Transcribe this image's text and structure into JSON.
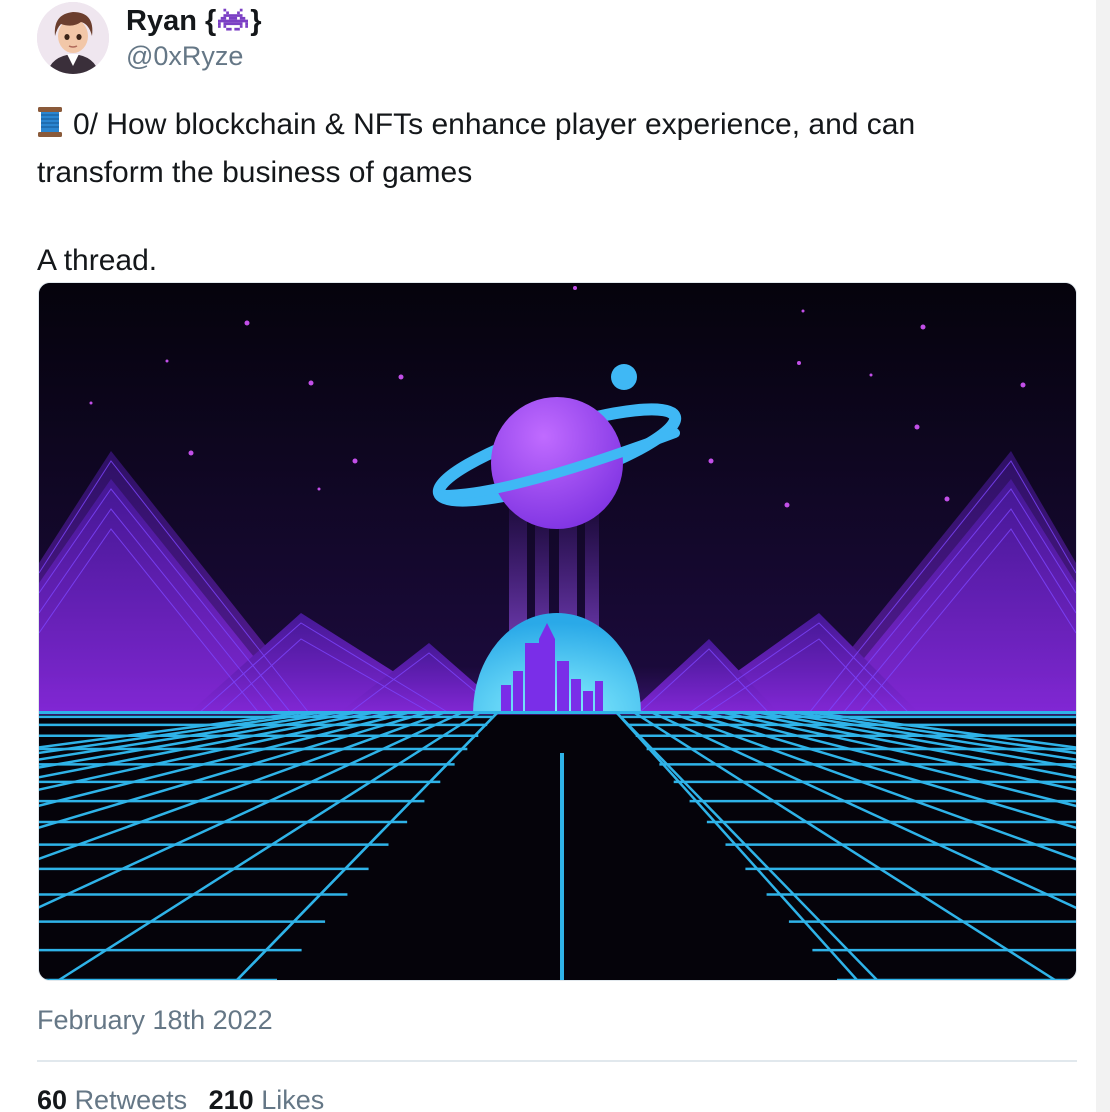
{
  "tweet": {
    "author": {
      "display_name": "Ryan {",
      "display_name_suffix": "}",
      "handle": "@0xRyze",
      "avatar_icon": "cartoon-avatar-icon",
      "name_emoji_icon": "alien-monster-icon"
    },
    "text": {
      "emoji_icon": "spool-of-thread-icon",
      "line1": "0/ How blockchain & NFTs enhance player experience, and can",
      "line2": "transform the business of games",
      "line3": "A thread."
    },
    "media": {
      "description_icon": "synthwave-planet-city-image",
      "colors": {
        "sky": "#06030f",
        "planet": "#9b4dff",
        "ring": "#3fb8f5",
        "grid": "#2fb3e8",
        "mountain": "#8a3cf0"
      }
    },
    "timestamp": "February 18th 2022",
    "stats": {
      "retweets_count": "60",
      "retweets_label": "Retweets",
      "likes_count": "210",
      "likes_label": "Likes"
    }
  }
}
